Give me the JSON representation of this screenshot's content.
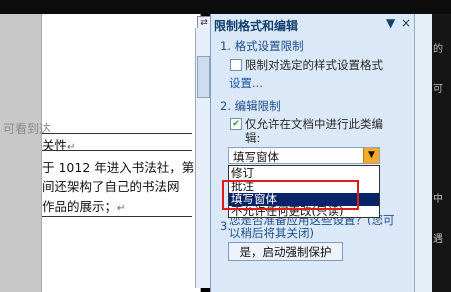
{
  "document": {
    "left_fragment": "可看到达",
    "lines": [
      "关性",
      "于 1012 年进入书法社，第",
      "间还架构了自己的书法网",
      "作品的展示；"
    ],
    "para_mark": "↵"
  },
  "pane": {
    "title": "限制格式和编辑",
    "controls": [
      "▼",
      "×"
    ],
    "section1": "1. 格式设置限制",
    "fmt_restrict_line1": "限制对选定的样式设置格式",
    "fmt_restrict_line2": "设置...",
    "section2": "2. 编辑限制",
    "edit_restrict_line1": "仅允许在文档中进行此类编",
    "edit_restrict_line2": "辑:",
    "select_value": "填写窗体",
    "options": [
      "修订",
      "批注",
      "填写窗体",
      "不允许任何更改(只读)"
    ],
    "section3_partial": "3.",
    "section3_text_line1": "您是否准备应用这些设置？(您可",
    "section3_text_line2": "以稍后将其关闭)",
    "start_button": "是，启动强制保护"
  },
  "right_fragments": [
    "的",
    "可",
    "中",
    "遇"
  ],
  "colors": {
    "pane_bg": "#dbe8f7",
    "title": "#15406e",
    "highlight_red": "#e01b1b",
    "dropdown_arrow": "#f7a928"
  }
}
